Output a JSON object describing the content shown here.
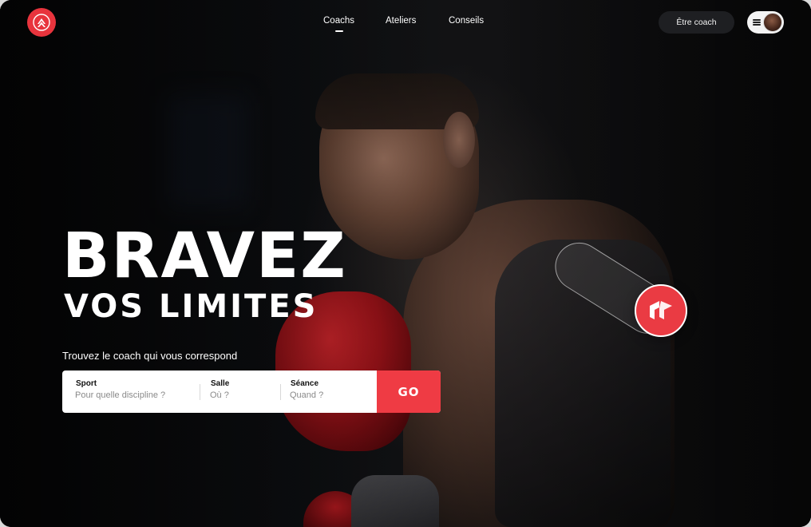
{
  "nav": {
    "items": [
      {
        "label": "Coachs",
        "active": true
      },
      {
        "label": "Ateliers",
        "active": false
      },
      {
        "label": "Conseils",
        "active": false
      }
    ]
  },
  "header": {
    "coach_button": "Être coach",
    "menu_icon": "hamburger-icon",
    "logo_icon": "brand-logo-icon"
  },
  "hero": {
    "title": "BRAVEZ",
    "subtitle": "VOS LIMITES",
    "tagline": "Trouvez le coach qui vous correspond"
  },
  "search": {
    "fields": [
      {
        "label": "Sport",
        "placeholder": "Pour quelle discipline ?"
      },
      {
        "label": "Salle",
        "placeholder": "Où ?"
      },
      {
        "label": "Séance",
        "placeholder": "Quand ?"
      }
    ],
    "go_label": "GO"
  },
  "colors": {
    "accent": "#ef3b44",
    "background": "#0a0a0b",
    "text": "#ffffff"
  }
}
